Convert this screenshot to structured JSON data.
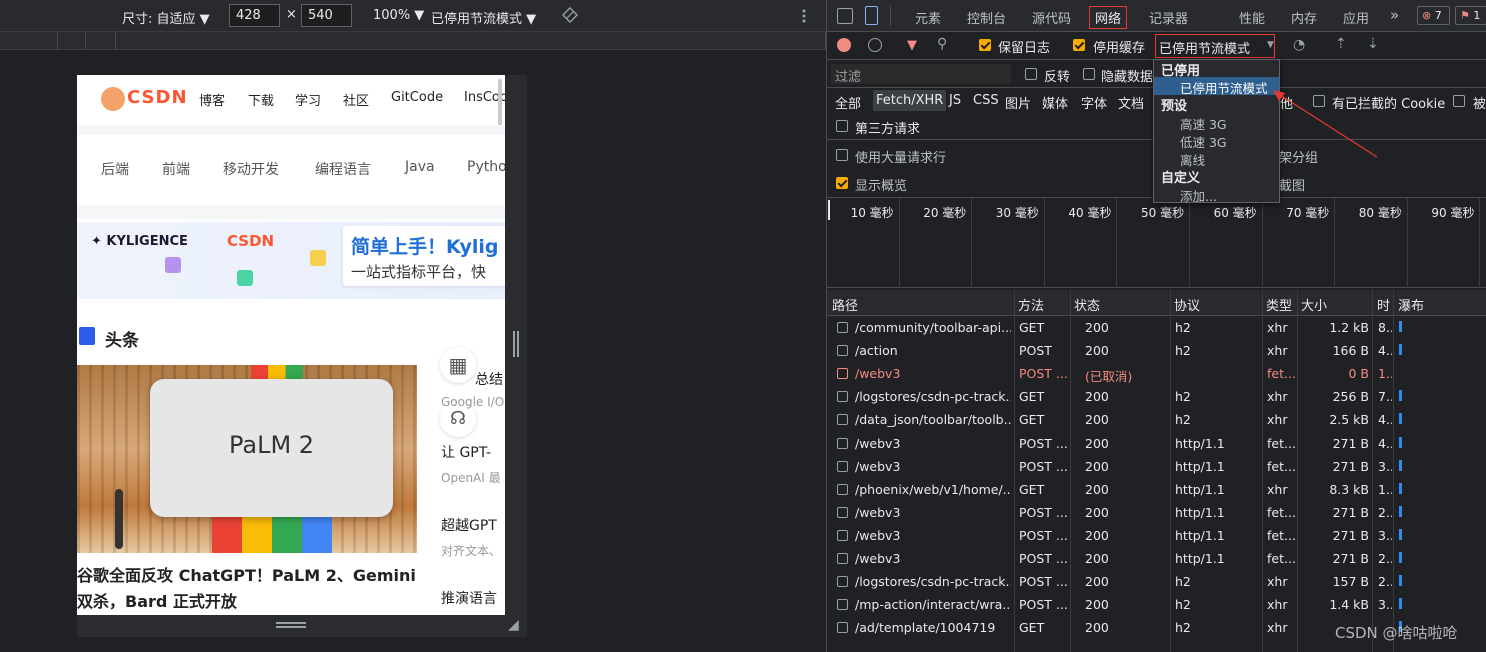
{
  "device_toolbar": {
    "dimensions_label": "尺寸: 自适应 ▼",
    "width_value": "428",
    "times": "×",
    "height_value": "540",
    "zoom_label": "100% ▼",
    "throttle_label": "已停用节流模式 ▼"
  },
  "csdn": {
    "logo_text": "CSDN",
    "nav": [
      "博客",
      "下载",
      "学习",
      "社区",
      "GitCode",
      "InsCode"
    ],
    "categories": [
      "后端",
      "前端",
      "移动开发",
      "编程语言",
      "Java",
      "Python"
    ],
    "banner_brand": "KYLIGENCE",
    "banner_brand2": "CSDN",
    "banner_title": "简单上手！Kylig",
    "banner_sub": "一站式指标平台，快",
    "section_title": "头条",
    "image_text": "PaLM 2",
    "headline": "谷歌全面反攻 ChatGPT！PaLM 2、Gemini 双杀，Bard 正式开放",
    "side_items": [
      {
        "title": "总结",
        "sub": "Google I/O"
      },
      {
        "title": "让 GPT-",
        "sub": "OpenAI 最"
      },
      {
        "title": "超越GPT",
        "sub": "对齐文本、"
      },
      {
        "title": "推演语言",
        "sub": ""
      }
    ]
  },
  "devtools": {
    "tabs": [
      "元素",
      "控制台",
      "源代码",
      "网络",
      "记录器",
      "性能",
      "内存",
      "应用"
    ],
    "active_tab": "网络",
    "more": "»",
    "error_count": "7",
    "issue_count": "1",
    "preserve_log": "保留日志",
    "disable_cache": "停用缓存",
    "throttle_value": "已停用节流模式",
    "filter_placeholder": "过滤",
    "invert": "反转",
    "hide_data": "隐藏数据",
    "types": [
      "全部",
      "Fetch/XHR",
      "JS",
      "CSS",
      "图片",
      "媒体",
      "字体",
      "文档"
    ],
    "other": "其他",
    "blocked_cookies": "有已拦截的 Cookie",
    "blocked_more": "被",
    "third_party": "第三方请求",
    "large_rows": "使用大量请求行",
    "group_by_frame": "按框架分组",
    "show_overview": "显示概览",
    "screenshots": "屏幕截图",
    "dropdown": {
      "group1": "已停用",
      "selected": "已停用节流模式",
      "group2": "预设",
      "presets": [
        "高速 3G",
        "低速 3G",
        "离线"
      ],
      "group3": "自定义",
      "add": "添加..."
    },
    "timeline_ticks": [
      "10 毫秒",
      "20 毫秒",
      "30 毫秒",
      "40 毫秒",
      "50 毫秒",
      "60 毫秒",
      "70 毫秒",
      "80 毫秒",
      "90 毫秒"
    ],
    "columns": [
      "路径",
      "方法",
      "状态",
      "协议",
      "类型",
      "大小",
      "时",
      "瀑布"
    ],
    "rows": [
      {
        "path": "/community/toolbar-api...",
        "method": "GET",
        "status": "200",
        "protocol": "h2",
        "type": "xhr",
        "size": "1.2 kB",
        "time": "8..",
        "error": false
      },
      {
        "path": "/action",
        "method": "POST",
        "status": "200",
        "protocol": "h2",
        "type": "xhr",
        "size": "166 B",
        "time": "4..",
        "error": false
      },
      {
        "path": "/webv3",
        "method": "POST ...",
        "status": "(已取消)",
        "protocol": "",
        "type": "fet...",
        "size": "0 B",
        "time": "1..",
        "error": true
      },
      {
        "path": "/logstores/csdn-pc-track...",
        "method": "GET",
        "status": "200",
        "protocol": "h2",
        "type": "xhr",
        "size": "256 B",
        "time": "7..",
        "error": false
      },
      {
        "path": "/data_json/toolbar/toolb...",
        "method": "GET",
        "status": "200",
        "protocol": "h2",
        "type": "xhr",
        "size": "2.5 kB",
        "time": "4..",
        "error": false
      },
      {
        "path": "/webv3",
        "method": "POST ...",
        "status": "200",
        "protocol": "http/1.1",
        "type": "fet...",
        "size": "271 B",
        "time": "4..",
        "error": false
      },
      {
        "path": "/webv3",
        "method": "POST ...",
        "status": "200",
        "protocol": "http/1.1",
        "type": "fet...",
        "size": "271 B",
        "time": "3..",
        "error": false
      },
      {
        "path": "/phoenix/web/v1/home/...",
        "method": "GET",
        "status": "200",
        "protocol": "http/1.1",
        "type": "xhr",
        "size": "8.3 kB",
        "time": "1..",
        "error": false
      },
      {
        "path": "/webv3",
        "method": "POST ...",
        "status": "200",
        "protocol": "http/1.1",
        "type": "fet...",
        "size": "271 B",
        "time": "2..",
        "error": false
      },
      {
        "path": "/webv3",
        "method": "POST ...",
        "status": "200",
        "protocol": "http/1.1",
        "type": "fet...",
        "size": "271 B",
        "time": "3..",
        "error": false
      },
      {
        "path": "/webv3",
        "method": "POST ...",
        "status": "200",
        "protocol": "http/1.1",
        "type": "fet...",
        "size": "271 B",
        "time": "2..",
        "error": false
      },
      {
        "path": "/logstores/csdn-pc-track...",
        "method": "POST ...",
        "status": "200",
        "protocol": "h2",
        "type": "xhr",
        "size": "157 B",
        "time": "2..",
        "error": false
      },
      {
        "path": "/mp-action/interact/wra...",
        "method": "POST ...",
        "status": "200",
        "protocol": "h2",
        "type": "xhr",
        "size": "1.4 kB",
        "time": "3..",
        "error": false
      },
      {
        "path": "/ad/template/1004719",
        "method": "GET",
        "status": "200",
        "protocol": "h2",
        "type": "xhr",
        "size": "",
        "time": "",
        "error": false
      }
    ],
    "watermark": "CSDN @啥咕啦呛"
  },
  "colors": {
    "accent_orange": "#f9ab00",
    "error_red": "#f28b82",
    "highlight_red": "#e53935",
    "csdn_red": "#fc5531"
  }
}
